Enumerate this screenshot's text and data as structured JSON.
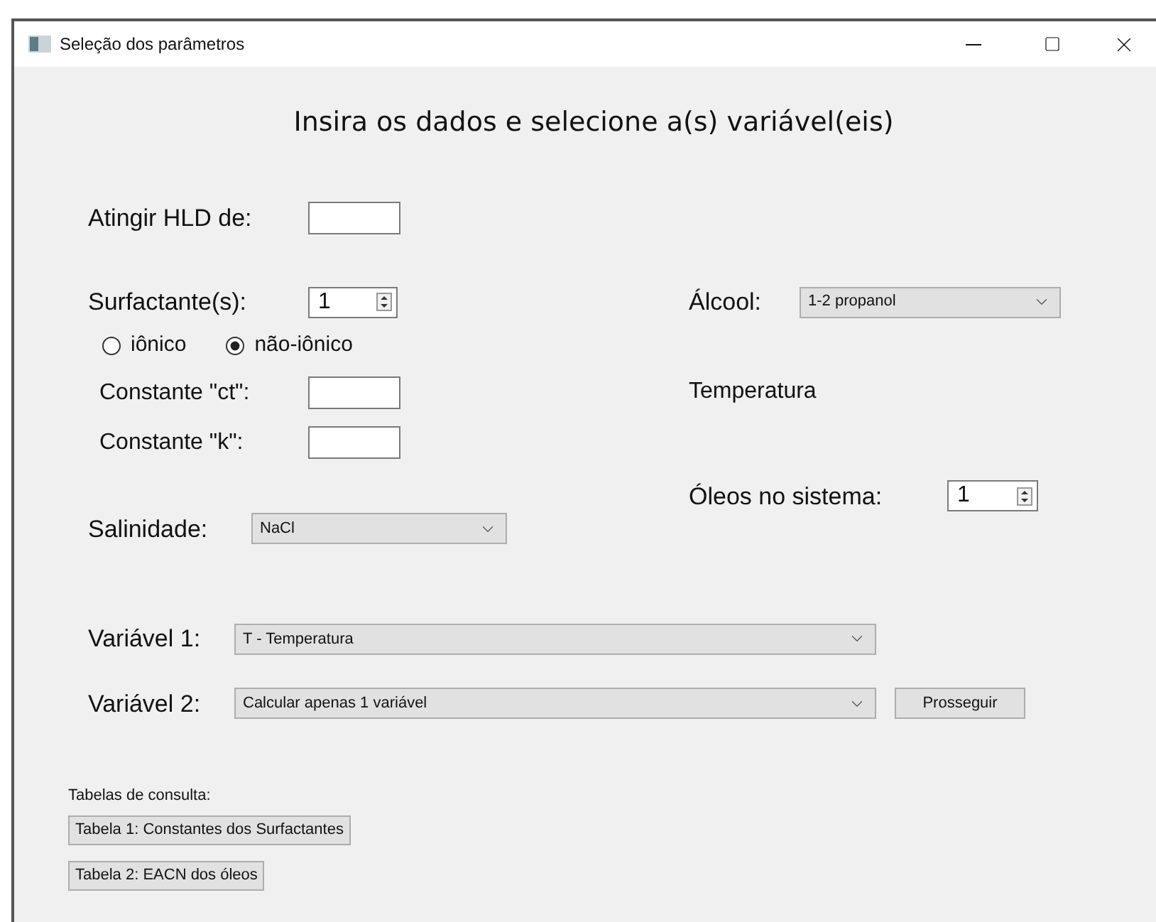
{
  "window": {
    "title": "Seleção dos parâmetros"
  },
  "heading": "Insira os dados e selecione a(s) variável(eis)",
  "hld": {
    "label": "Atingir HLD de:"
  },
  "surfactants": {
    "label": "Surfactante(s):",
    "value": "1"
  },
  "surfactant_type": [
    {
      "label": "iônico",
      "selected": false
    },
    {
      "label": "não-iônico",
      "selected": true
    }
  ],
  "constants": [
    {
      "label": "Constante \"ct\":"
    },
    {
      "label": "Constante \"k\":"
    }
  ],
  "salinity": {
    "label": "Salinidade:",
    "value": "NaCl"
  },
  "alcohol": {
    "label": "Álcool:",
    "value": "1-2 propanol"
  },
  "temperature_label": "Temperatura",
  "oils": {
    "label": "Óleos no sistema:",
    "value": "1"
  },
  "variables": [
    {
      "label": "Variável 1:",
      "value": "T - Temperatura"
    },
    {
      "label": "Variável 2:",
      "value": "Calcular apenas 1 variável"
    }
  ],
  "proceed_button": "Prosseguir",
  "reference": {
    "label": "Tabelas de consulta:",
    "buttons": [
      "Tabela 1: Constantes dos Surfactantes",
      "Tabela 2: EACN dos óleos"
    ]
  }
}
